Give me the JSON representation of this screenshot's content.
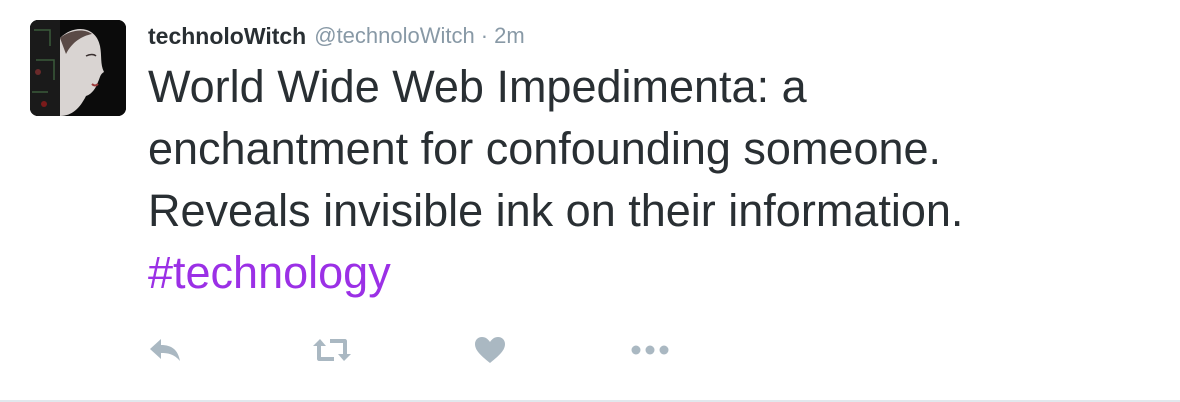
{
  "tweet": {
    "fullname": "technoloWitch",
    "handle": "@technoloWitch",
    "separator": "·",
    "timestamp": "2m",
    "text_lines": [
      "World Wide Web Impedimenta: a",
      "enchantment for confounding someone.",
      "Reveals invisible ink on their information."
    ],
    "hashtag": "#technology",
    "colors": {
      "text": "#292f33",
      "secondary": "#8899a6",
      "hashtag": "#9b30e6",
      "action_icon": "#aab8c2"
    }
  },
  "actions": {
    "reply_icon": "reply-icon",
    "retweet_icon": "retweet-icon",
    "like_icon": "heart-icon",
    "more_icon": "more-icon"
  }
}
